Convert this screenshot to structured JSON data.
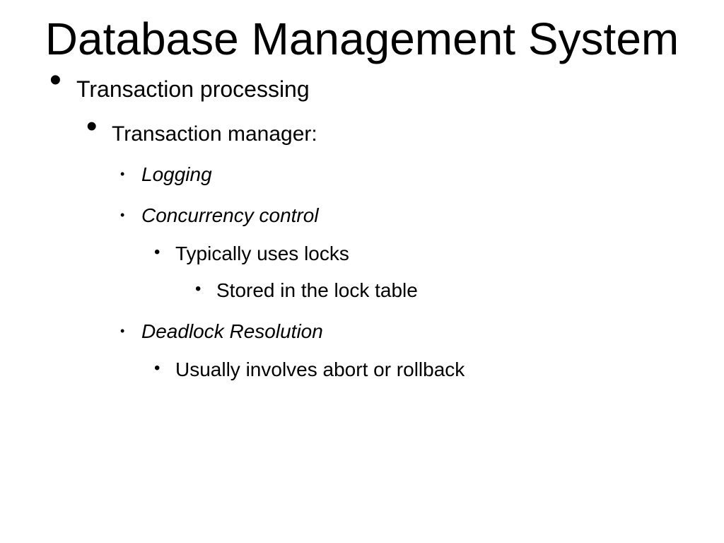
{
  "title": "Database Management System",
  "bullets": {
    "l1_0": "Transaction processing",
    "l2_0": "Transaction manager:",
    "l3_0": "Logging",
    "l3_1": "Concurrency control",
    "l4_0": "Typically uses locks",
    "l5_0": "Stored in the lock table",
    "l3_2": "Deadlock Resolution",
    "l4_1": "Usually involves abort or rollback"
  }
}
